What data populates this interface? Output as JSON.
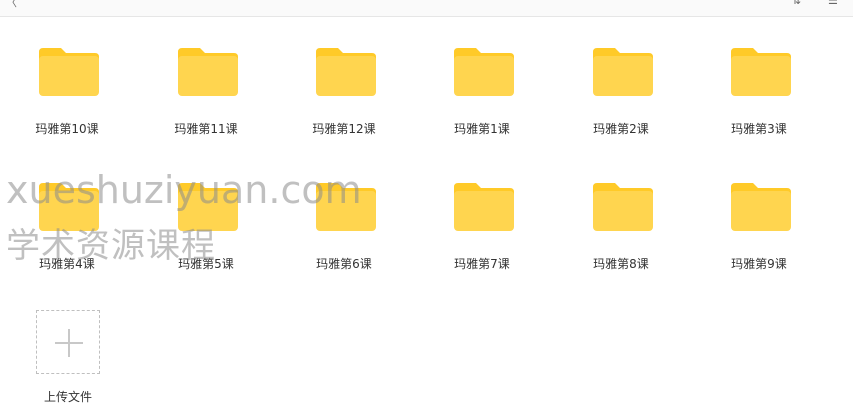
{
  "folders": [
    {
      "label": "玛雅第10课"
    },
    {
      "label": "玛雅第11课"
    },
    {
      "label": "玛雅第12课"
    },
    {
      "label": "玛雅第1课"
    },
    {
      "label": "玛雅第2课"
    },
    {
      "label": "玛雅第3课"
    },
    {
      "label": "玛雅第4课"
    },
    {
      "label": "玛雅第5课"
    },
    {
      "label": "玛雅第6课"
    },
    {
      "label": "玛雅第7课"
    },
    {
      "label": "玛雅第8课"
    },
    {
      "label": "玛雅第9课"
    }
  ],
  "upload": {
    "label": "上传文件"
  },
  "watermark": {
    "line1": "xueshuziyuan.com",
    "line2": "学术资源课程"
  },
  "colors": {
    "folder_body": "#FFD54F",
    "folder_tab": "#FFCA28",
    "text": "#333333"
  },
  "icons": {
    "folder": "folder-icon",
    "upload": "plus-icon"
  }
}
